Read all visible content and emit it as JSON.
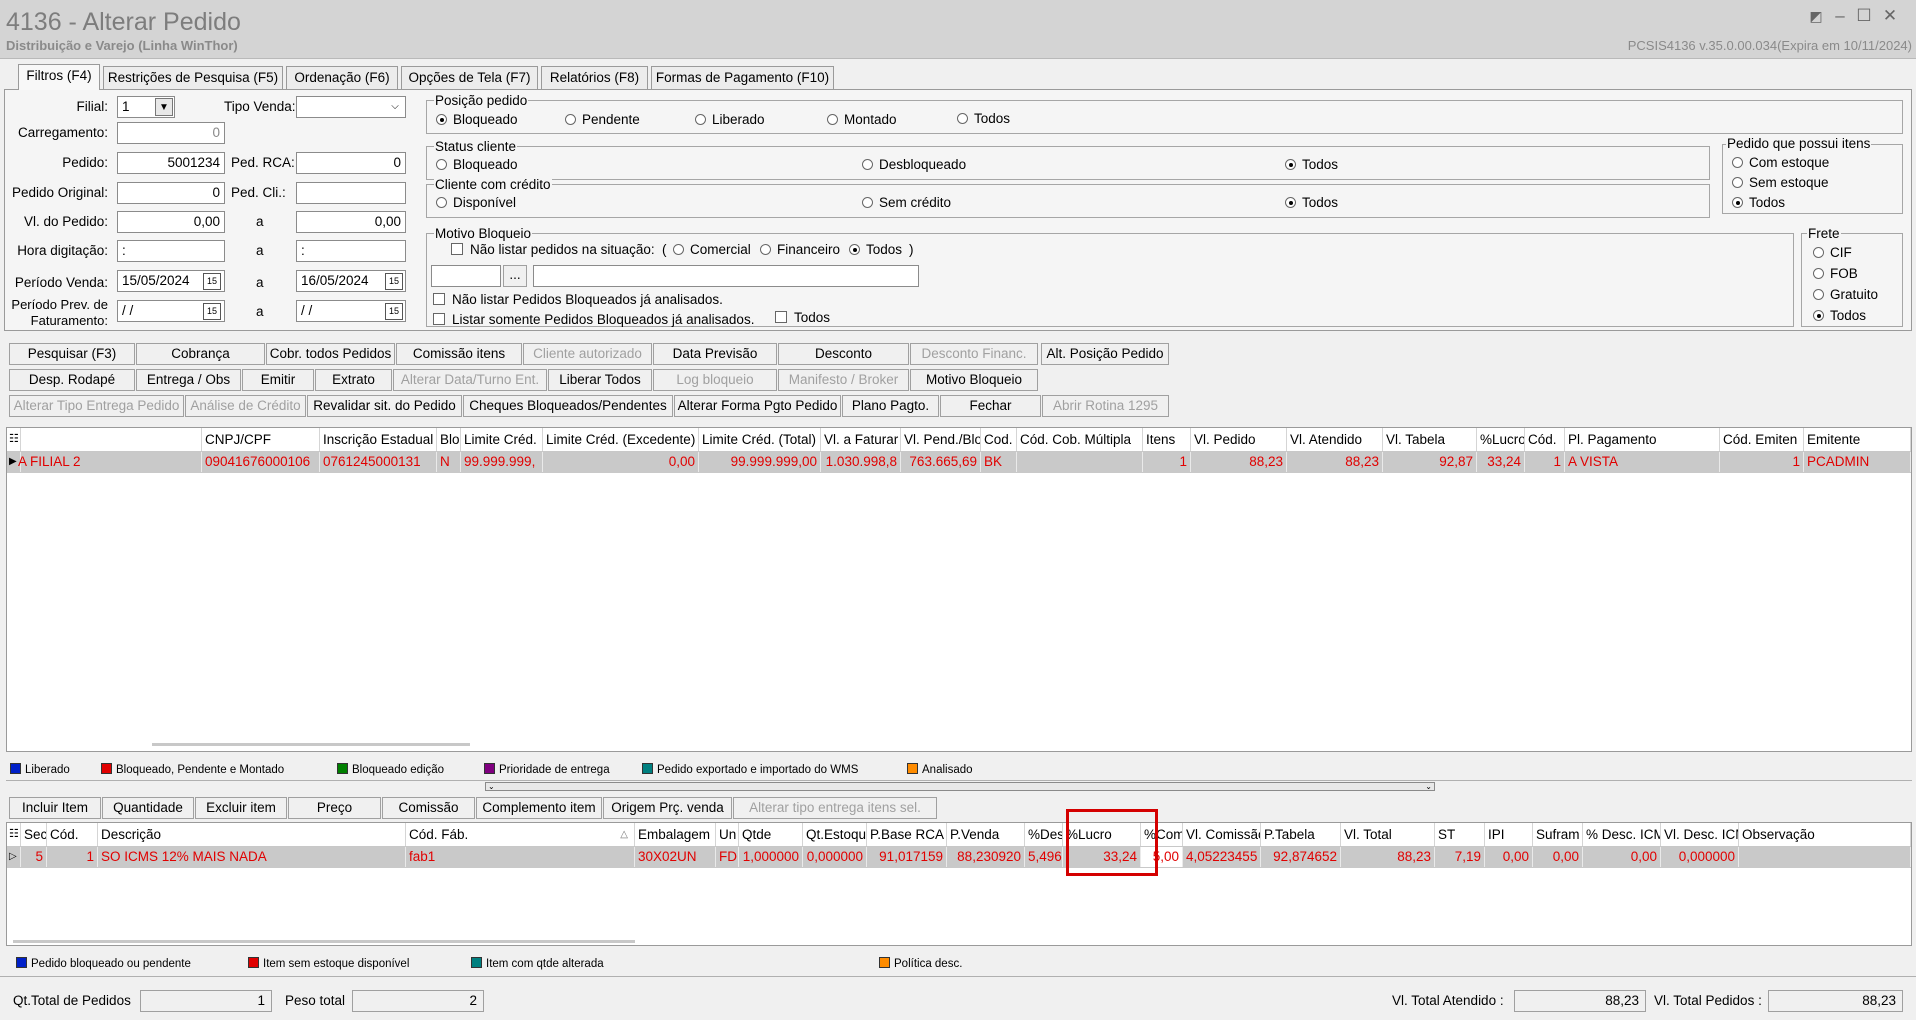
{
  "window": {
    "title": "4136 - Alterar Pedido",
    "subtitle": "Distribuição e Varejo (Linha WinThor)",
    "version": "PCSIS4136  v.35.0.00.034(Expira em 10/11/2024)"
  },
  "tabs": [
    "Filtros (F4)",
    "Restrições de Pesquisa (F5)",
    "Ordenação (F6)",
    "Opções de Tela (F7)",
    "Relatórios (F8)",
    "Formas de Pagamento (F10)"
  ],
  "filters": {
    "filial_label": "Filial:",
    "filial_value": "1",
    "tipo_venda_label": "Tipo Venda:",
    "tipo_venda_value": "",
    "carregamento_label": "Carregamento:",
    "carregamento_value": "0",
    "pedido_label": "Pedido:",
    "pedido_value": "5001234",
    "ped_rca_label": "Ped. RCA:",
    "ped_rca_value": "0",
    "pedido_original_label": "Pedido Original:",
    "pedido_original_value": "0",
    "ped_cli_label": "Ped. Cli.:",
    "ped_cli_value": "",
    "vl_pedido_label": "Vl. do Pedido:",
    "vl_pedido_from": "0,00",
    "vl_pedido_to": "0,00",
    "a_label": "a",
    "hora_label": "Hora digitação:",
    "hora_from": " :",
    "hora_to": " :",
    "periodo_venda_label": "Período Venda:",
    "periodo_venda_from": "15/05/2024",
    "periodo_venda_to": "16/05/2024",
    "periodo_prev_label1": "Período Prev. de",
    "periodo_prev_label2": "Faturamento:",
    "periodo_prev_from": " /  /",
    "periodo_prev_to": " /  /",
    "cal_icon": "15"
  },
  "posicao": {
    "title": "Posição pedido",
    "options": [
      "Bloqueado",
      "Pendente",
      "Liberado",
      "Montado",
      "Todos"
    ],
    "selected": 0
  },
  "status_cliente": {
    "title": "Status cliente",
    "options": [
      "Bloqueado",
      "Desbloqueado",
      "Todos"
    ],
    "selected": 2
  },
  "cliente_credito": {
    "title": "Cliente com crédito",
    "options": [
      "Disponível",
      "Sem crédito",
      "Todos"
    ],
    "selected": 2
  },
  "pedido_itens": {
    "title": "Pedido que possui itens",
    "options": [
      "Com estoque",
      "Sem estoque",
      "Todos"
    ],
    "selected": 2
  },
  "motivo": {
    "title": "Motivo Bloqueio",
    "nao_listar": "Não listar pedidos na situação:",
    "paren_open": "(",
    "paren_close": ")",
    "options": [
      "Comercial",
      "Financeiro",
      "Todos"
    ],
    "selected": 2,
    "ellipsis": "...",
    "nao_listar_analisados": "Não listar Pedidos Bloqueados já analisados.",
    "listar_somente": "Listar somente Pedidos Bloqueados já analisados.",
    "todos": "Todos"
  },
  "frete": {
    "title": "Frete",
    "options": [
      "CIF",
      "FOB",
      "Gratuito",
      "Todos"
    ],
    "selected": 3
  },
  "buttons_row1": [
    "Pesquisar (F3)",
    "Cobrança",
    "Cobr. todos Pedidos",
    "Comissão itens",
    "Cliente autorizado",
    "Data Previsão",
    "Desconto",
    "Desconto Financ.",
    "Alt. Posição Pedido"
  ],
  "buttons_row2": [
    "Desp. Rodapé",
    "Entrega / Obs",
    "Emitir",
    "Extrato",
    "Alterar Data/Turno Ent.",
    "Liberar Todos",
    "Log bloqueio",
    "Manifesto / Broker",
    "Motivo Bloqueio"
  ],
  "buttons_row3": [
    "Alterar Tipo Entrega Pedido",
    "Análise de Crédito",
    "Revalidar sit. do Pedido",
    "Cheques Bloqueados/Pendentes",
    "Alterar Forma Pgto Pedido",
    "Plano Pagto.",
    "Fechar",
    "Abrir Rotina 1295"
  ],
  "orders_grid": {
    "headers": [
      "",
      "CNPJ/CPF",
      "Inscrição Estadual",
      "Blo",
      "Limite Créd.",
      "Limite Créd. (Excedente)",
      "Limite Créd. (Total)",
      "Vl. a Faturar",
      "Vl. Pend./Blo",
      "Cod.",
      "Cód. Cob. Múltipla",
      "Itens",
      "Vl. Pedido",
      "Vl. Atendido",
      "Vl. Tabela",
      "%Lucro",
      "Cód.",
      "Pl. Pagamento",
      "Cód. Emiten",
      "Emitente"
    ],
    "row": [
      "A FILIAL 2",
      "09041676000106",
      "0761245000131",
      "N",
      "99.999.999,",
      "0,00",
      "99.999.999,00",
      "1.030.998,8",
      "763.665,69",
      "BK",
      "",
      "1",
      "88,23",
      "88,23",
      "92,87",
      "33,24",
      "1",
      "A VISTA",
      "1",
      "PCADMIN"
    ]
  },
  "legend1": [
    {
      "label": "Liberado",
      "color": "#0020c8"
    },
    {
      "label": "Bloqueado, Pendente e Montado",
      "color": "#e00000"
    },
    {
      "label": "Bloqueado edição",
      "color": "#008000"
    },
    {
      "label": "Prioridade de entrega",
      "color": "#800080"
    },
    {
      "label": "Pedido exportado e importado do WMS",
      "color": "#008080"
    },
    {
      "label": "Analisado",
      "color": "#ff8c00"
    }
  ],
  "item_buttons": [
    "Incluir Item",
    "Quantidade",
    "Excluir item",
    "Preço",
    "Comissão",
    "Complemento item",
    "Origem Prç. venda",
    "Alterar tipo entrega itens sel."
  ],
  "items_grid": {
    "headers": [
      "Sec",
      "Cód.",
      "Descrição",
      "Cód. Fáb.",
      "Embalagem",
      "Un",
      "Qtde",
      "Qt.Estoqu",
      "P.Base RCA",
      "P.Venda",
      "%Des",
      "%Lucro",
      "%Com.",
      "Vl. Comissão",
      "P.Tabela",
      "Vl. Total",
      "ST",
      "IPI",
      "Sufram",
      "% Desc. ICM",
      "Vl. Desc. ICM",
      "Observação"
    ],
    "row": [
      "5",
      "1",
      "SO ICMS 12% MAIS NADA",
      "fab1",
      "30X02UN",
      "FD",
      "1,000000",
      "0,000000",
      "91,017159",
      "88,230920",
      "5,496",
      "33,24",
      "5,00",
      "4,05223455",
      "92,874652",
      "88,23",
      "7,19",
      "0,00",
      "0,00",
      "0,00",
      "0,000000",
      ""
    ]
  },
  "legend2": [
    {
      "label": "Pedido bloqueado ou pendente",
      "color": "#0020c8"
    },
    {
      "label": "Item sem estoque disponível",
      "color": "#e00000"
    },
    {
      "label": "Item com qtde alterada",
      "color": "#008080"
    },
    {
      "label": "Política desc.",
      "color": "#ff8c00"
    }
  ],
  "status": {
    "qt_total_label": "Qt.Total de Pedidos",
    "qt_total_value": "1",
    "peso_label": "Peso total",
    "peso_value": "2",
    "vl_atendido_label": "Vl. Total Atendido :",
    "vl_atendido_value": "88,23",
    "vl_pedidos_label": "Vl. Total Pedidos :",
    "vl_pedidos_value": "88,23"
  },
  "colors": {
    "highlight": "#d40000",
    "row_text": "#e10000",
    "row_bg": "#c9c9c9"
  }
}
